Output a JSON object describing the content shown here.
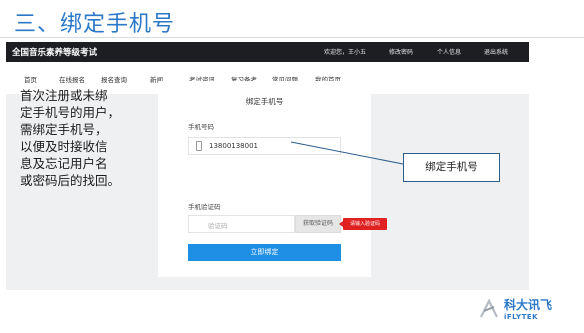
{
  "slide": {
    "title": "三、绑定手机号"
  },
  "app": {
    "site_title": "全国音乐素养等级考试",
    "topbar_links": [
      "欢迎您，王小五",
      "修改密码",
      "个人信息",
      "退出系统"
    ],
    "nav": [
      "首页",
      "在线报名",
      "报名查询",
      "新闻",
      "考试资讯",
      "复习备考",
      "常见问题",
      "我的首页"
    ]
  },
  "instructions": [
    "首次注册或未绑",
    "定手机号的用户，",
    "需绑定手机号，",
    "以便及时接收信",
    "息及忘记用户名",
    "或密码后的找回。"
  ],
  "card": {
    "title": "绑定手机号",
    "phone_label": "手机号码",
    "phone_value": "13800138001",
    "code_label": "手机验证码",
    "code_placeholder": "验证码",
    "get_code_button": "获取验证码",
    "error_tip": "请输入验证码",
    "submit_button": "立即绑定"
  },
  "callout": "绑定手机号",
  "logo": {
    "name_cn": "科大讯飞",
    "name_en": "iFLYTEK"
  },
  "colors": {
    "title_blue": "#2b78c8",
    "topbar": "#1c1e22",
    "primary_button": "#1f8fe6",
    "error": "#e02121"
  },
  "icons": [
    "phone-icon",
    "iflytek-logo-icon"
  ]
}
